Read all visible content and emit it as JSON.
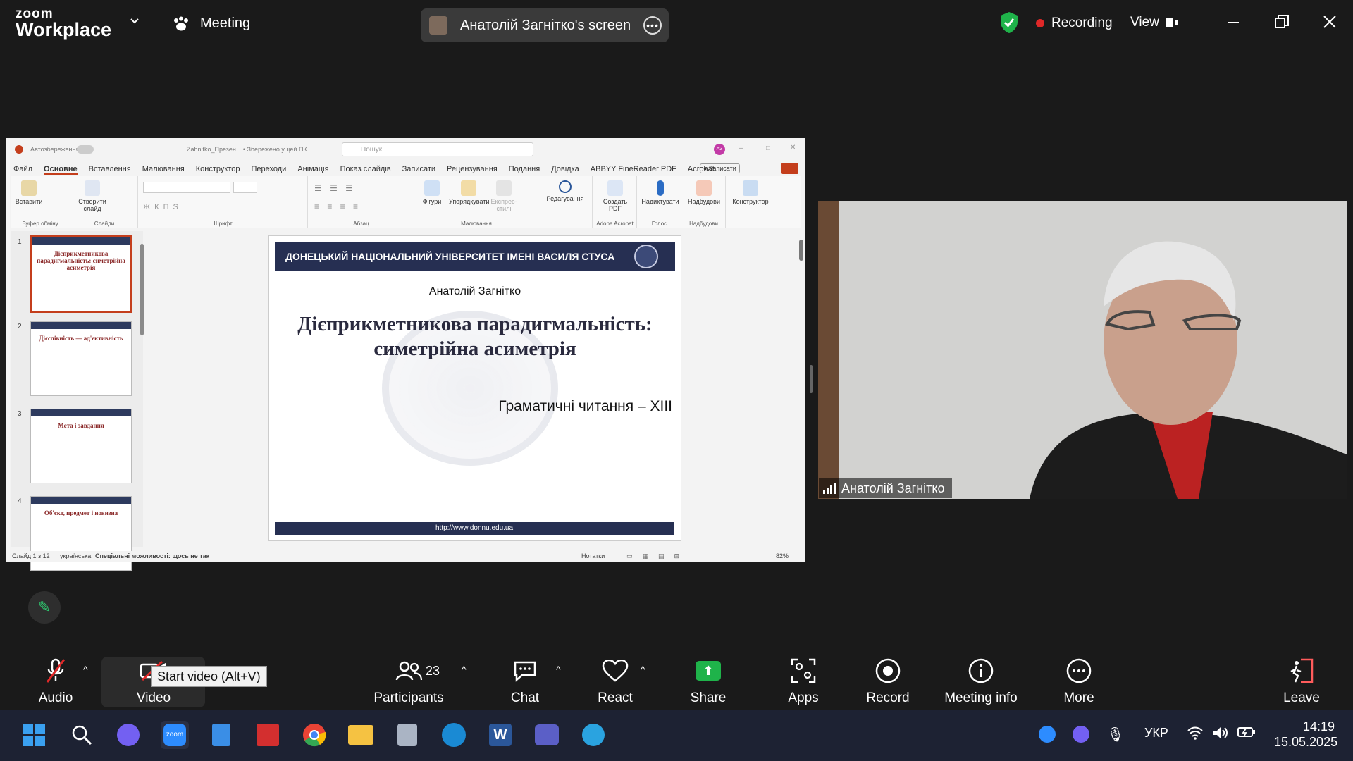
{
  "app": {
    "logo_top": "zoom",
    "logo_bottom": "Workplace",
    "meeting_label": "Meeting"
  },
  "share_banner": {
    "text": "Анатолій Загнітко's screen"
  },
  "status": {
    "recording": "Recording",
    "view": "View"
  },
  "colors": {
    "recording_dot": "#e02828",
    "shield": "#1fb34a",
    "share_green": "#1fb34a",
    "slide_navy": "#262f52",
    "slide_title": "#2a2a3e",
    "ppt_accent": "#c43e1c"
  },
  "ppt": {
    "autosave": "Автозбереження",
    "file_title": "Zahnitko_Презен... • Збережено у цей ПК",
    "search": "Пошук",
    "user": "АЗ",
    "menu": [
      "Файл",
      "Основне",
      "Вставлення",
      "Малювання",
      "Конструктор",
      "Переходи",
      "Анімація",
      "Показ слайдів",
      "Записати",
      "Рецензування",
      "Подання",
      "Довідка",
      "ABBYY FineReader PDF",
      "Acrobat"
    ],
    "record_btn": "Записати",
    "ribbon": {
      "paste": "Вставити",
      "clipboard": "Буфер обміну",
      "new_slide": "Створити слайд",
      "slides": "Слайди",
      "font": "Шрифт",
      "paragraph": "Абзац",
      "shapes": "Фігури",
      "arrange": "Упорядкувати",
      "quick_styles": "Експрес-стилі",
      "drawing": "Малювання",
      "editing": "Редагування",
      "create_pdf": "Создать PDF",
      "adobe": "Adobe Acrobat",
      "dictate": "Надиктувати",
      "voice": "Голос",
      "addins": "Надбудови",
      "addins_group": "Надбудови",
      "designer": "Конструктор"
    },
    "thumbs": [
      {
        "n": "1",
        "title": "Дієприкметникова парадигмальність: симетрійна асиметрія"
      },
      {
        "n": "2",
        "title": "Дієслівність — ад'єктивність"
      },
      {
        "n": "3",
        "title": "Мета і завдання"
      },
      {
        "n": "4",
        "title": "Об'єкт, предмет і новизна"
      }
    ],
    "slide": {
      "header": "ДОНЕЦЬКИЙ НАЦІОНАЛЬНИЙ УНІВЕРСИТЕТ ІМЕНІ ВАСИЛЯ СТУСА",
      "author": "Анатолій Загнітко",
      "title_line1": "Дієприкметникова парадигмальність:",
      "title_line2": "симетрійна асиметрія",
      "subtitle": "Граматичні читання – ХІІІ",
      "footer": "http://www.donnu.edu.ua"
    },
    "statusbar": {
      "slide": "Слайд 1 з 12",
      "lang": "українська",
      "access": "Спеціальні можливості: щось не так",
      "notes": "Нотатки",
      "zoom": "82%"
    }
  },
  "video": {
    "name": "Анатолій Загнітко"
  },
  "toolbar": {
    "audio": "Audio",
    "video": "Video",
    "tooltip": "Start video (Alt+V)",
    "participants": "Participants",
    "participants_count": "23",
    "chat": "Chat",
    "react": "React",
    "share": "Share",
    "apps": "Apps",
    "record": "Record",
    "meeting_info": "Meeting info",
    "more": "More",
    "leave": "Leave"
  },
  "taskbar": {
    "lang": "УКР",
    "time": "14:19",
    "date": "15.05.2025"
  }
}
